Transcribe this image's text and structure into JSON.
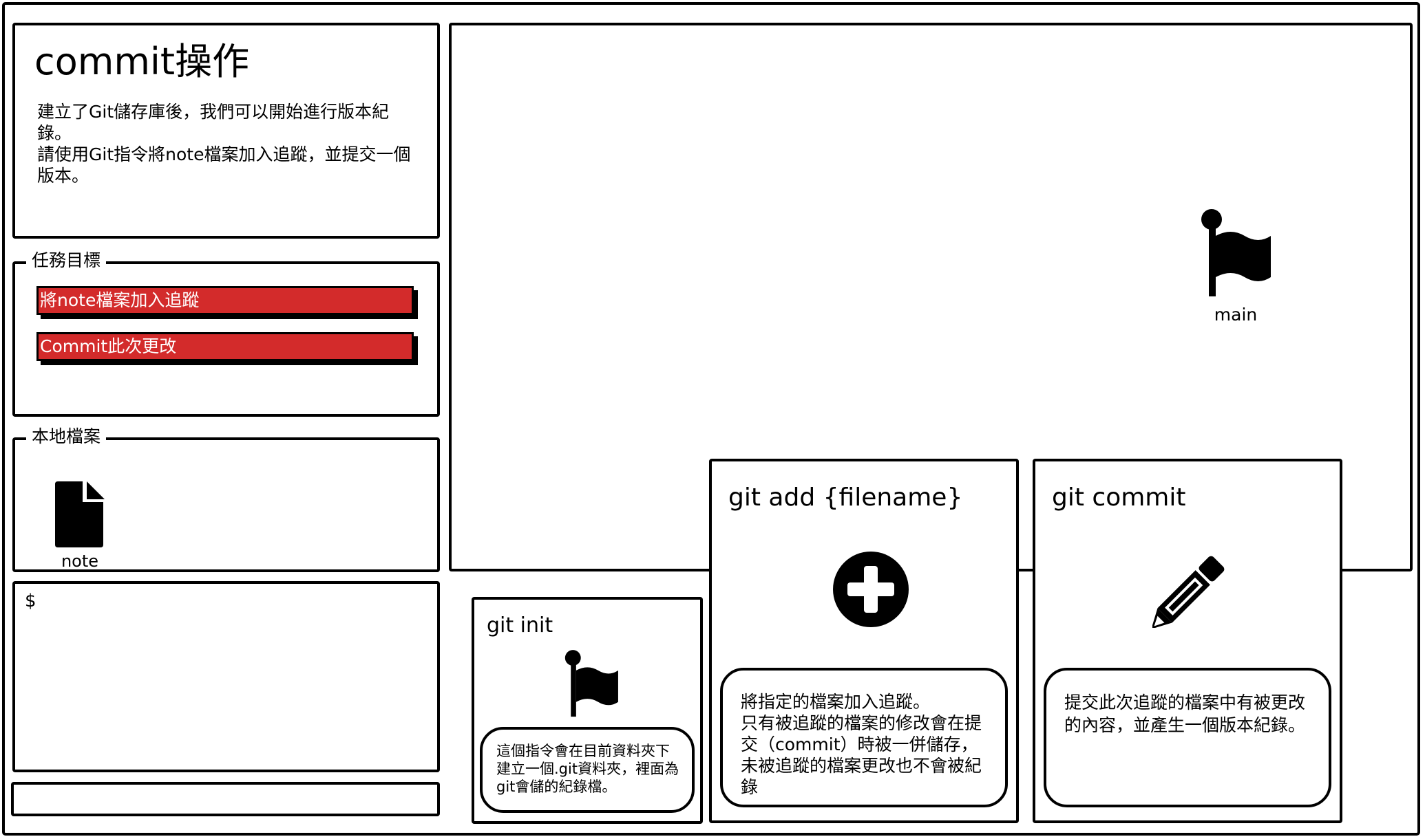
{
  "intro": {
    "title": "commit操作",
    "description": "建立了Git儲存庫後，我們可以開始進行版本紀錄。\n請使用Git指令將note檔案加入追蹤，並提交一個版本。"
  },
  "goals": {
    "legend": "任務目標",
    "items": [
      {
        "label": "將note檔案加入追蹤"
      },
      {
        "label": "Commit此次更改"
      }
    ]
  },
  "files": {
    "legend": "本地檔案",
    "items": [
      {
        "name": "note",
        "icon": "file-icon"
      }
    ]
  },
  "terminal": {
    "prompt": "$"
  },
  "graph": {
    "branch_label": "main",
    "branch_icon": "flag-icon"
  },
  "commands": {
    "init": {
      "title": "git init",
      "icon": "flag-icon",
      "description": "這個指令會在目前資料夾下建立一個.git資料夾，裡面為git會儲的紀錄檔。"
    },
    "add": {
      "title": "git add {filename}",
      "icon": "plus-circle-icon",
      "description": "將指定的檔案加入追蹤。\n只有被追蹤的檔案的修改會在提交（commit）時被一併儲存，未被追蹤的檔案更改也不會被紀錄"
    },
    "commit": {
      "title": "git commit",
      "icon": "pencil-icon",
      "description": "提交此次追蹤的檔案中有被更改的內容，並產生一個版本紀錄。"
    }
  },
  "colors": {
    "goal_background": "#d32b2b",
    "border": "#000000"
  }
}
